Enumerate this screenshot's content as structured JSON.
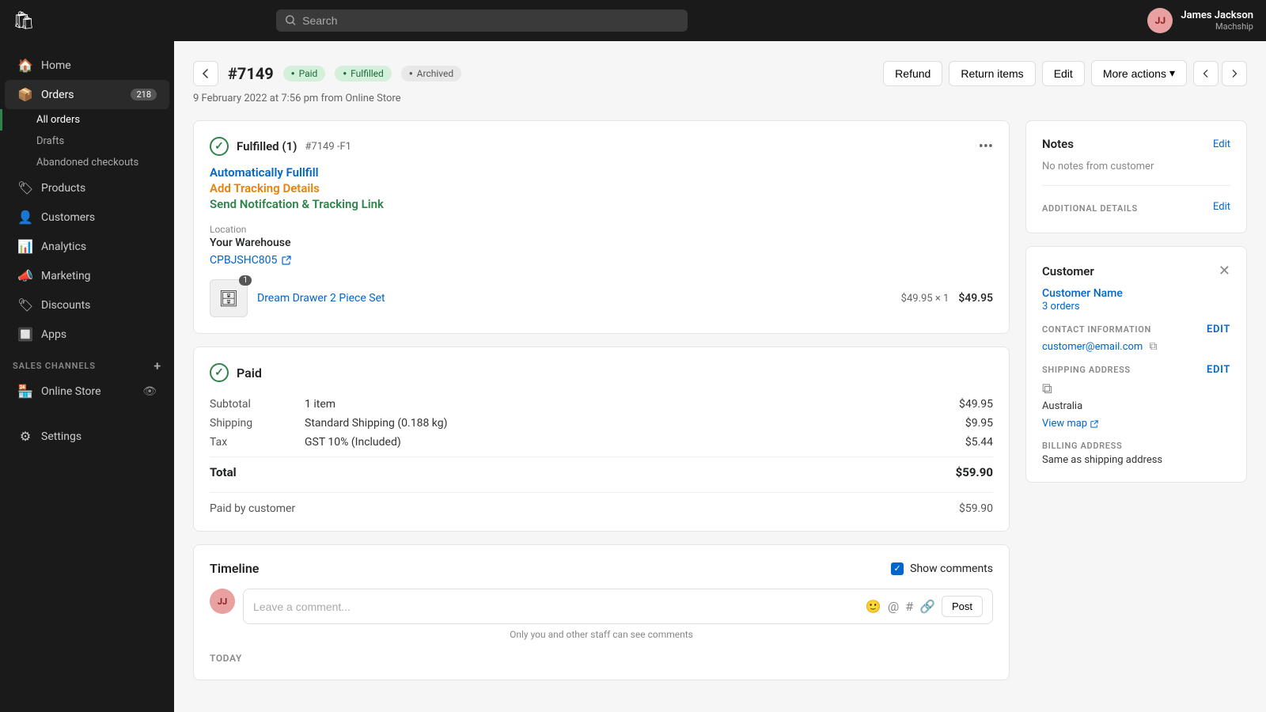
{
  "topnav": {
    "search_placeholder": "Search",
    "user_name": "James Jackson",
    "user_shop": "Machship",
    "user_initials": "JJ",
    "logo": "🛍"
  },
  "sidebar": {
    "items": [
      {
        "id": "home",
        "label": "Home",
        "icon": "🏠"
      },
      {
        "id": "orders",
        "label": "Orders",
        "icon": "📦",
        "badge": "218"
      },
      {
        "id": "products",
        "label": "Products",
        "icon": "🏷"
      },
      {
        "id": "customers",
        "label": "Customers",
        "icon": "👤"
      },
      {
        "id": "analytics",
        "label": "Analytics",
        "icon": "📊"
      },
      {
        "id": "marketing",
        "label": "Marketing",
        "icon": "📣"
      },
      {
        "id": "discounts",
        "label": "Discounts",
        "icon": "🏷"
      },
      {
        "id": "apps",
        "label": "Apps",
        "icon": "🔲"
      }
    ],
    "sub_items": [
      {
        "id": "all-orders",
        "label": "All orders",
        "active": true
      },
      {
        "id": "drafts",
        "label": "Drafts"
      },
      {
        "id": "abandoned",
        "label": "Abandoned checkouts"
      }
    ],
    "sales_channels_title": "SALES CHANNELS",
    "online_store": "Online Store",
    "settings": "Settings"
  },
  "order": {
    "number": "#7149",
    "status_paid": "Paid",
    "status_fulfilled": "Fulfilled",
    "status_archived": "Archived",
    "date": "9 February 2022 at 7:56 pm from Online Store",
    "refund_btn": "Refund",
    "return_items_btn": "Return items",
    "edit_btn": "Edit",
    "more_actions_btn": "More actions"
  },
  "fulfillment": {
    "title": "Fulfilled (1)",
    "id": "#7149 -F1",
    "action_1": "Automatically Fullfill",
    "action_2": "Add Tracking Details",
    "action_3": "Send Notifcation & Tracking Link",
    "location_label": "Location",
    "location": "Your Warehouse",
    "tracking_code": "CPBJSHC805",
    "product_name": "Dream Drawer 2 Piece Set",
    "product_qty": "1",
    "product_price": "$49.95 × 1",
    "product_total": "$49.95"
  },
  "payment": {
    "title": "Paid",
    "subtotal_label": "Subtotal",
    "subtotal_desc": "1 item",
    "subtotal_amount": "$49.95",
    "shipping_label": "Shipping",
    "shipping_desc": "Standard Shipping (0.188 kg)",
    "shipping_amount": "$9.95",
    "tax_label": "Tax",
    "tax_desc": "GST 10% (Included)",
    "tax_amount": "$5.44",
    "total_label": "Total",
    "total_amount": "$59.90",
    "paid_by_label": "Paid by customer",
    "paid_by_amount": "$59.90"
  },
  "timeline": {
    "title": "Timeline",
    "show_comments_label": "Show comments",
    "comment_placeholder": "Leave a comment...",
    "post_btn": "Post",
    "comment_note": "Only you and other staff can see comments",
    "today_label": "TODAY",
    "user_initials": "JJ"
  },
  "notes": {
    "title": "Notes",
    "edit_label": "Edit",
    "no_notes": "No notes from customer",
    "additional_details_title": "ADDITIONAL DETAILS",
    "additional_edit_label": "Edit"
  },
  "customer": {
    "title": "Customer",
    "name": "Customer Name",
    "orders": "3 orders",
    "contact_title": "CONTACT INFORMATION",
    "contact_edit": "Edit",
    "email": "customer@email.com",
    "shipping_title": "SHIPPING ADDRESS",
    "shipping_edit": "Edit",
    "country": "Australia",
    "view_map": "View map",
    "billing_title": "BILLING ADDRESS",
    "billing_value": "Same as shipping address"
  }
}
